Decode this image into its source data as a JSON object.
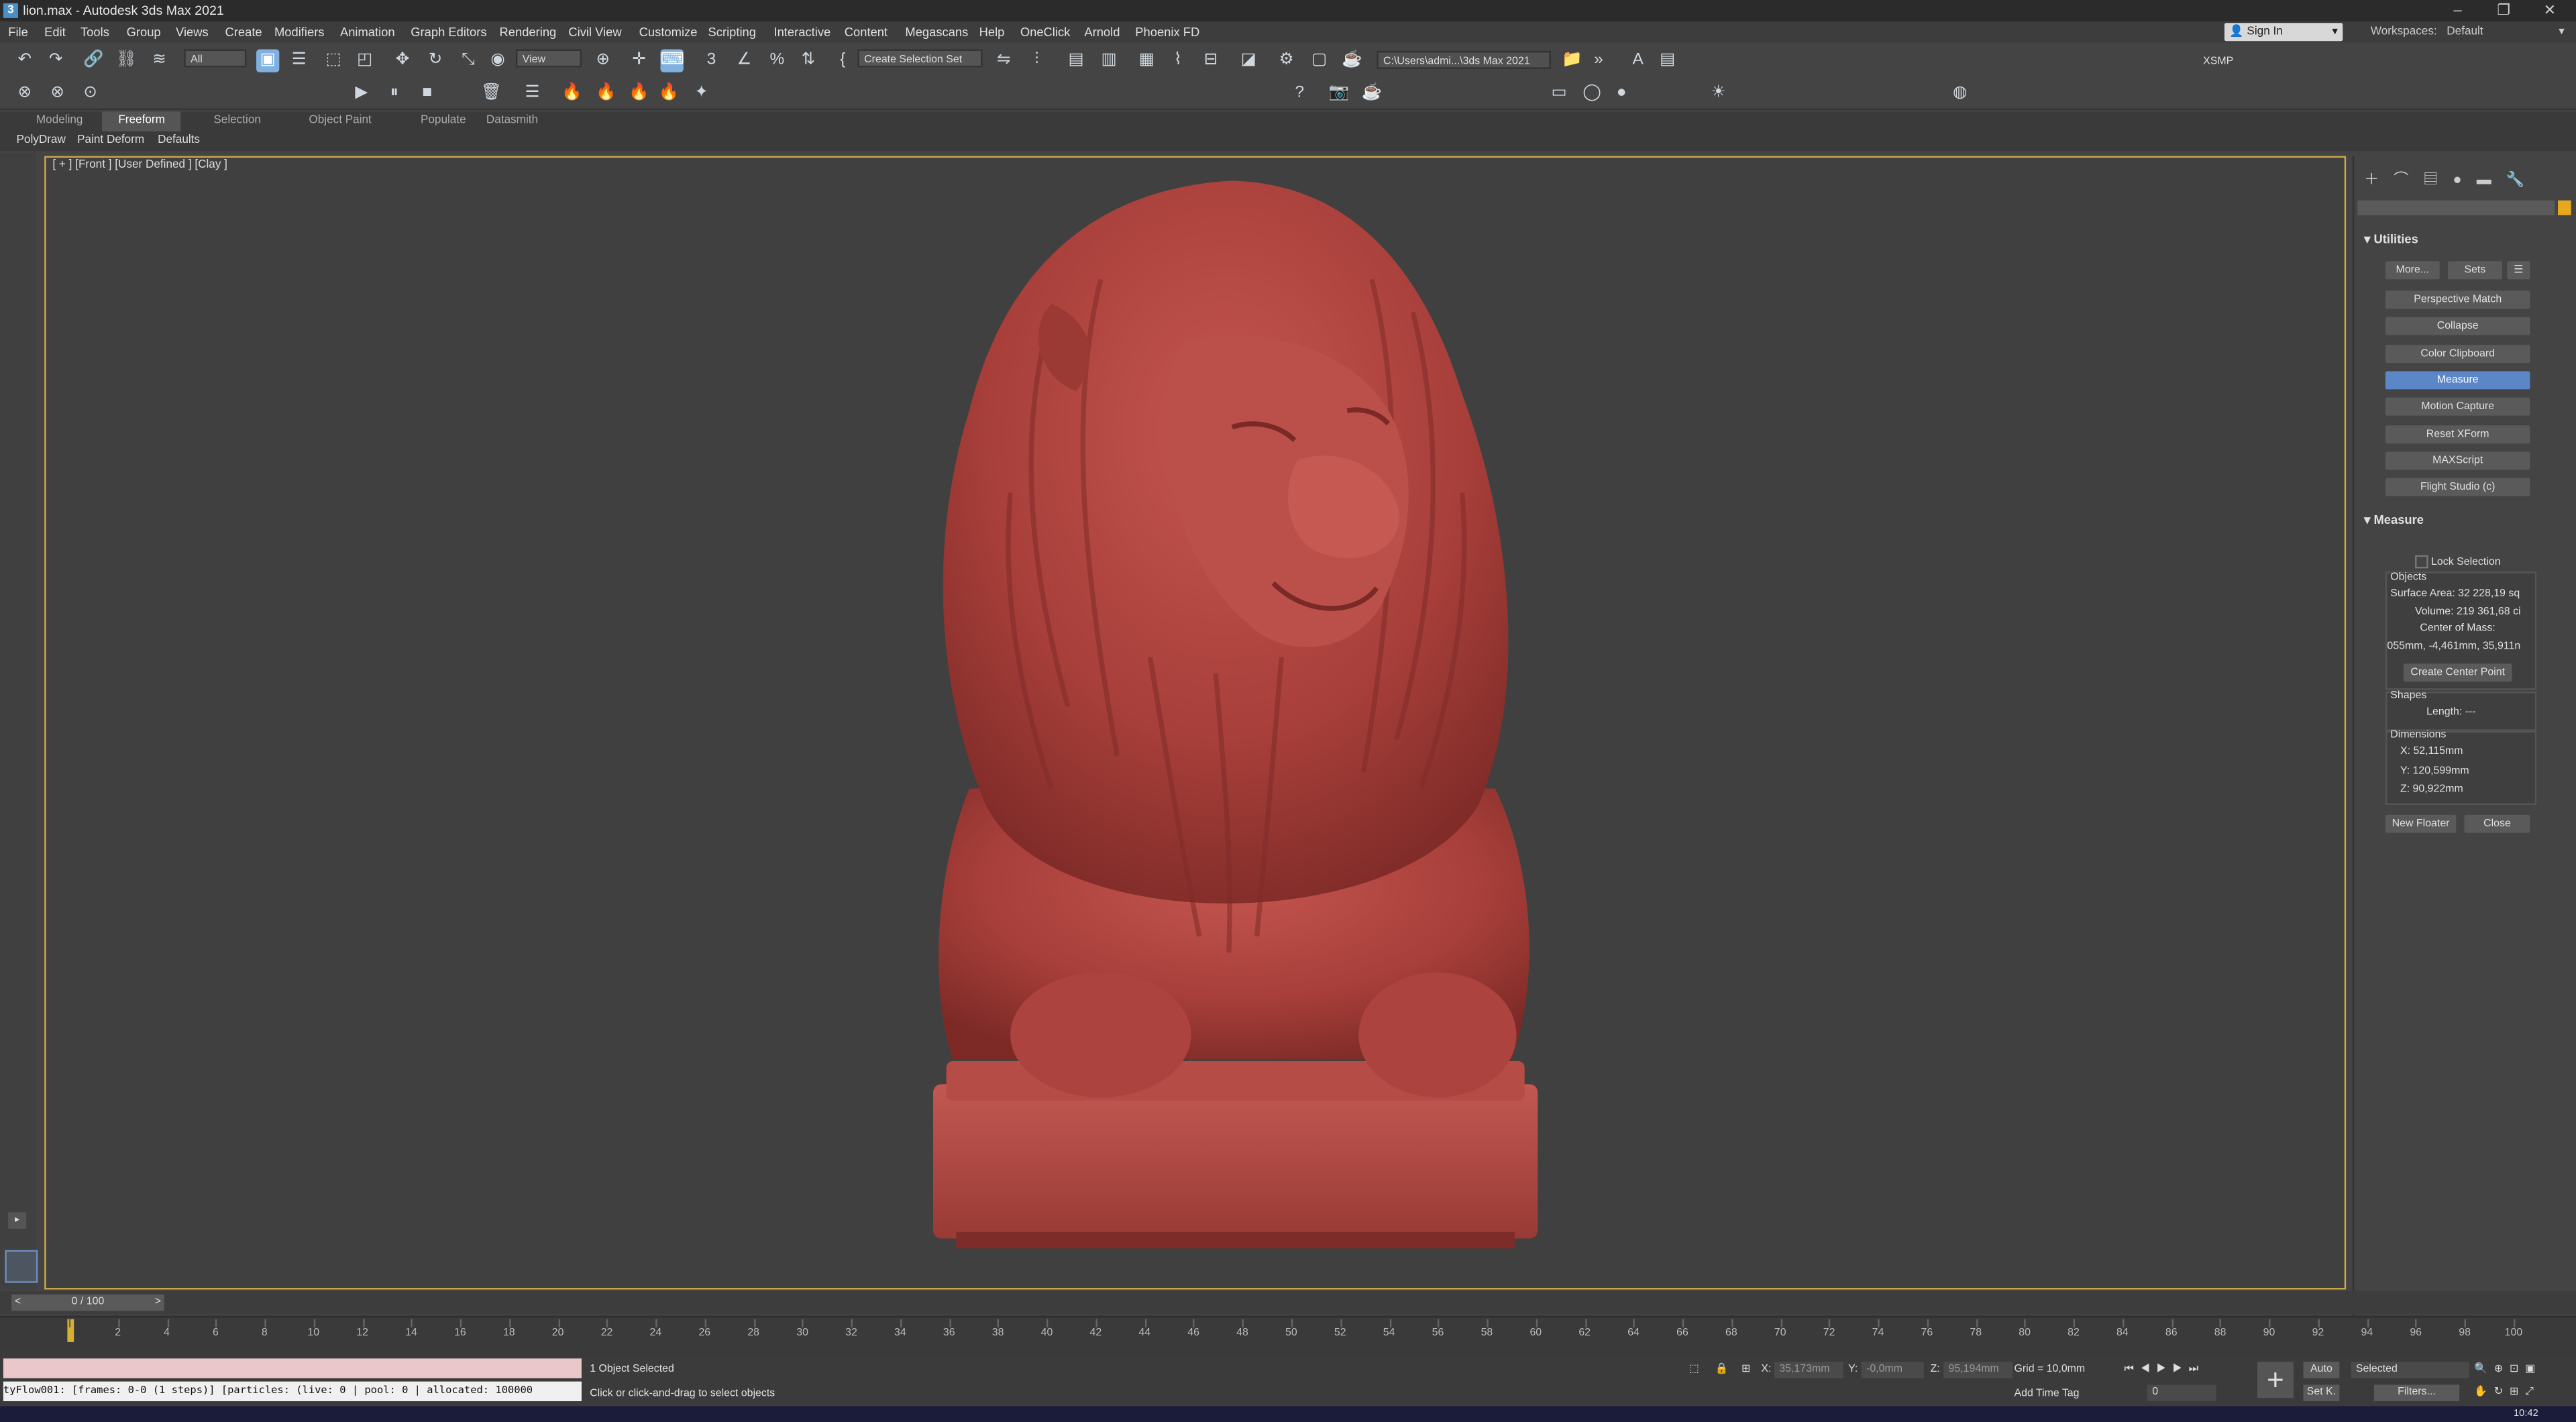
{
  "window": {
    "title": "lion.max - Autodesk 3ds Max 2021"
  },
  "menu": [
    "File",
    "Edit",
    "Tools",
    "Group",
    "Views",
    "Create",
    "Modifiers",
    "Animation",
    "Graph Editors",
    "Rendering",
    "Civil View",
    "Customize",
    "Scripting",
    "Interactive",
    "Content",
    "Megascans",
    "Help",
    "OneClick",
    "Arnold",
    "Phoenix FD"
  ],
  "account": {
    "signin": "Sign In",
    "workspaces_label": "Workspaces:",
    "workspace": "Default"
  },
  "toolbar": {
    "filter": "All",
    "refcoord": "View",
    "selection_set": "Create Selection Set",
    "path": "C:\\Users\\admi...\\3ds Max 2021",
    "xsmp": "XSMP"
  },
  "ribbon_tabs": [
    "Modeling",
    "Freeform",
    "Selection",
    "Object Paint",
    "Populate",
    "Datasmith"
  ],
  "ribbon_active": "Freeform",
  "sub_ribbon": [
    "PolyDraw",
    "Paint Deform",
    "Defaults"
  ],
  "viewport": {
    "label": "[ + ] [Front ] [User Defined ] [Clay ]",
    "model_color": "#b04540"
  },
  "utilities": {
    "title": "Utilities",
    "more": "More...",
    "sets": "Sets",
    "buttons": [
      "Perspective Match",
      "Collapse",
      "Color Clipboard",
      "Measure",
      "Motion Capture",
      "Reset XForm",
      "MAXScript",
      "Flight Studio (c)"
    ],
    "active": "Measure"
  },
  "measure": {
    "title": "Measure",
    "lock": "Lock Selection",
    "objects_label": "Objects",
    "surface_area": "Surface Area: 32 228,19 sq",
    "volume": "Volume: 219 361,68 ci",
    "center_label": "Center of Mass:",
    "center_value": "055mm, -4,461mm, 35,911n",
    "create_center": "Create Center Point",
    "shapes_label": "Shapes",
    "length": "Length: ---",
    "dimensions_label": "Dimensions",
    "x": "X: 52,115mm",
    "y": "Y: 120,599mm",
    "z": "Z: 90,922mm",
    "new_floater": "New Floater",
    "close": "Close"
  },
  "timeline": {
    "frame": "0 / 100",
    "ticks": [
      "0",
      "2",
      "4",
      "6",
      "8",
      "10",
      "12",
      "14",
      "16",
      "18",
      "20",
      "22",
      "24",
      "26",
      "28",
      "30",
      "32",
      "34",
      "36",
      "38",
      "40",
      "42",
      "44",
      "46",
      "48",
      "50",
      "52",
      "54",
      "56",
      "58",
      "60",
      "62",
      "64",
      "66",
      "68",
      "70",
      "72",
      "74",
      "76",
      "78",
      "80",
      "82",
      "84",
      "86",
      "88",
      "90",
      "92",
      "94",
      "96",
      "98",
      "100"
    ]
  },
  "status": {
    "script_line": "tyFlow001: [frames: 0-0 (1 steps)] [particles: (live: 0 | pool: 0 | allocated: 100000",
    "selected": "1 Object Selected",
    "prompt": "Click or click-and-drag to select objects",
    "x_label": "X:",
    "x_val": "35,173mm",
    "y_label": "Y:",
    "y_val": "-0,0mm",
    "z_label": "Z:",
    "z_val": "95,194mm",
    "grid": "Grid = 10,0mm",
    "time_tag": "Add Time Tag",
    "auto": "Auto",
    "setk": "Set K.",
    "selected_dd": "Selected",
    "filters": "Filters...",
    "frame_spinner": "0",
    "clock": "10:42"
  }
}
